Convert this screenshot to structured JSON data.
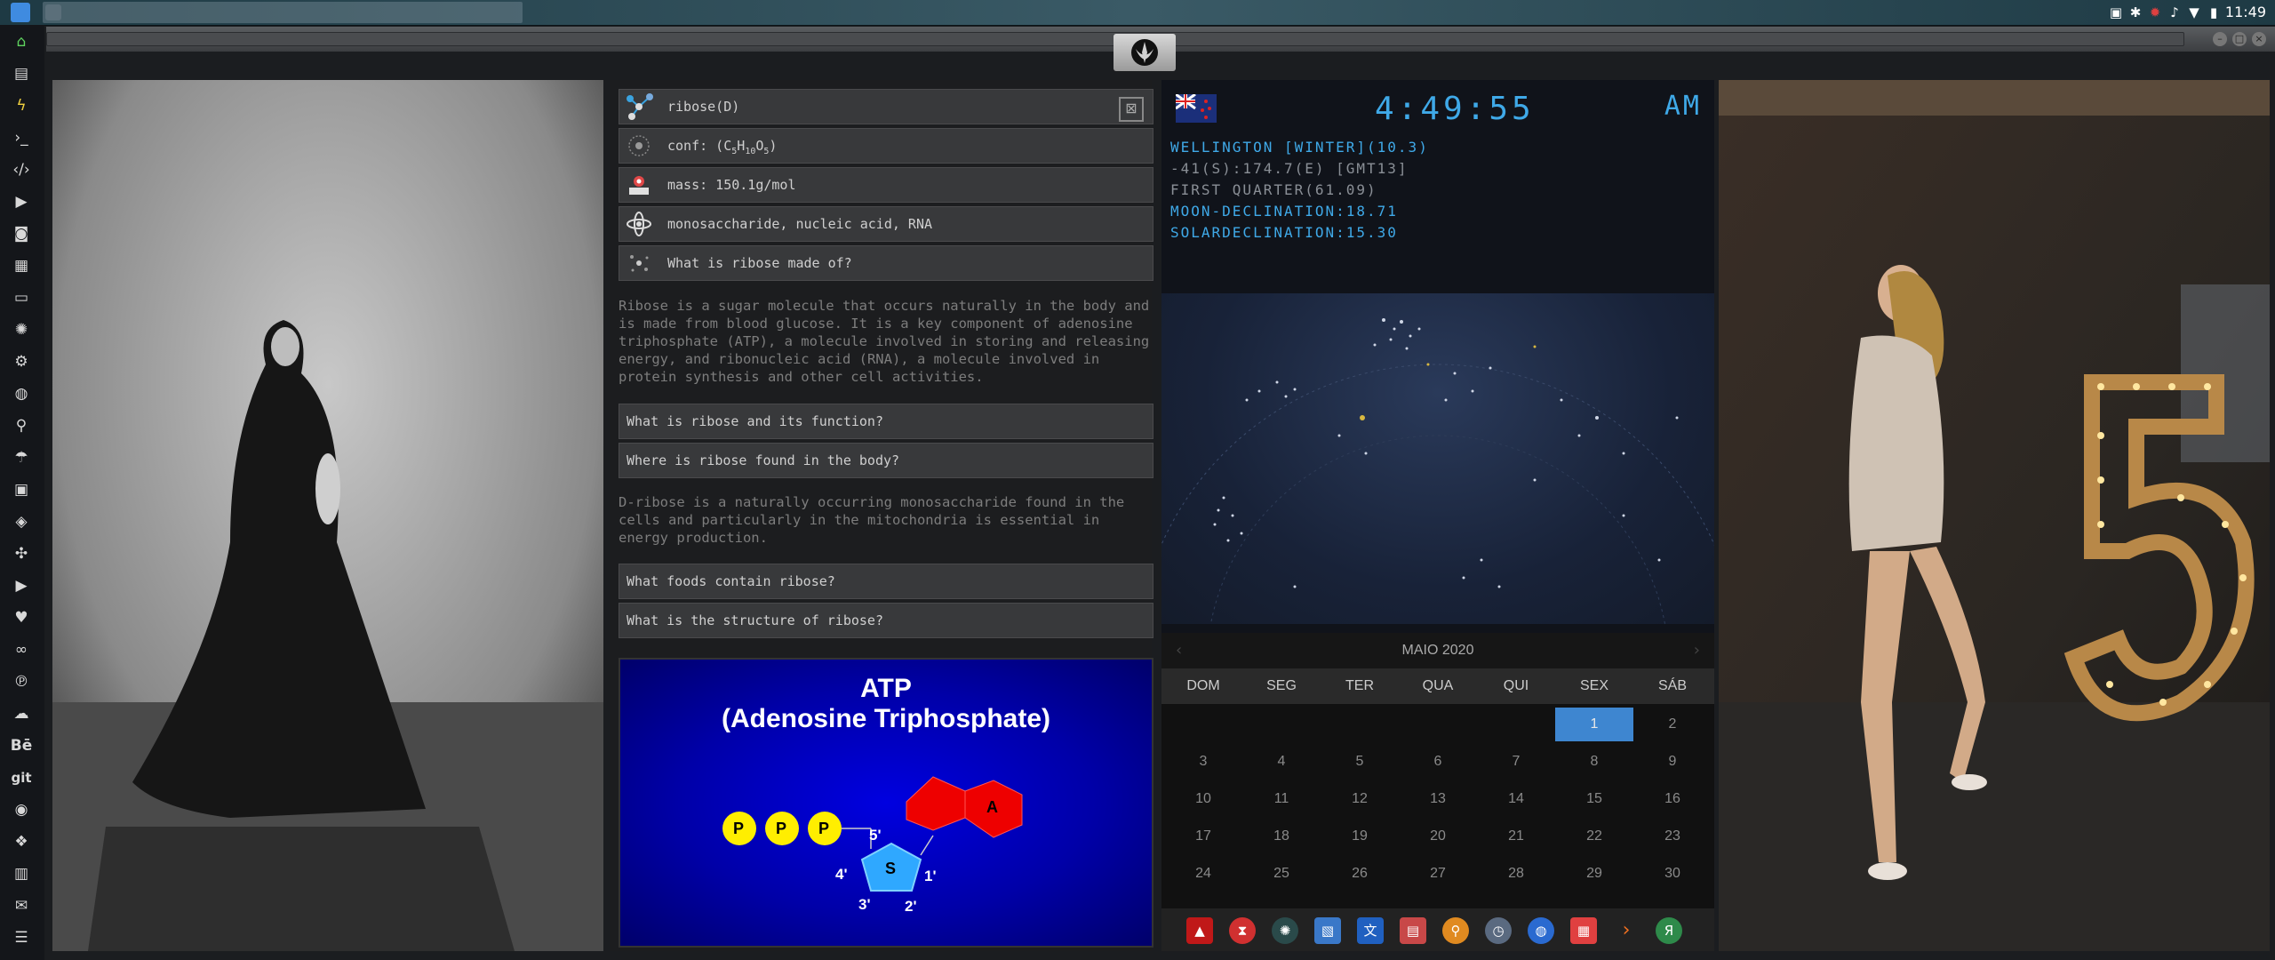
{
  "topbar": {
    "clock": "11:49",
    "tray_icons": [
      "screenshot-icon",
      "bluetooth-icon",
      "bug-icon",
      "volume-icon",
      "wifi-icon",
      "battery-icon"
    ]
  },
  "window": {
    "tab_icon": "rebel-alliance-icon"
  },
  "dock": {
    "items": [
      "home-icon",
      "document-icon",
      "bolt-icon",
      "terminal-icon",
      "code-icon",
      "media-icon",
      "camera-icon",
      "image-icon",
      "id-card-icon",
      "aperture-icon",
      "gear-icon",
      "globe-icon",
      "search-icon",
      "umbrella-icon",
      "contacts-icon",
      "layers-icon",
      "network-icon",
      "youtube-icon",
      "heart-icon",
      "infinity-icon",
      "pinterest-icon",
      "cloud-icon",
      "behance-icon",
      "git-icon",
      "github-icon",
      "cubes-icon",
      "map-icon",
      "mail-icon",
      "server-icon"
    ],
    "behance_label": "Bē",
    "git_label": "git"
  },
  "info": {
    "rows": [
      {
        "icon": "molecule-icon",
        "text": "ribose(D)"
      },
      {
        "icon": "atom-icon",
        "text": "conf: (C5H10O5)"
      },
      {
        "icon": "scale-icon",
        "text": "mass: 150.1g/mol"
      },
      {
        "icon": "orbit-icon",
        "text": "monosaccharide, nucleic acid, RNA"
      },
      {
        "icon": "sparkle-icon",
        "text": "What is ribose made of?"
      }
    ],
    "para1": "Ribose is a sugar molecule that occurs naturally in the body and is made from blood glucose. It is a key component of adenosine triphosphate (ATP), a molecule involved in storing and releasing energy, and ribonucleic acid (RNA), a molecule involved in protein synthesis and other cell activities.",
    "q1": "What is ribose and its function?",
    "q2": "Where is ribose found in the body?",
    "para2": "D-ribose is a naturally occurring monosaccharide found in the cells and particularly in the mitochondria is essential in energy production.",
    "q3": "What foods contain ribose?",
    "q4": "What is the structure of ribose?",
    "close_symbol": "⊠",
    "atp": {
      "title1": "ATP",
      "title2": "(Adenosine Triphosphate)",
      "p": "P",
      "s": "S",
      "a": "A",
      "c5": "5'",
      "c4": "4'",
      "c3": "3'",
      "c2": "2'",
      "c1": "1'"
    }
  },
  "astro": {
    "time": "4:49:55",
    "ampm": "AM",
    "line1": "WELLINGTON [WINTER](10.3)",
    "line2": "-41(S):174.7(E) [GMT13]",
    "line3": "FIRST QUARTER(61.09)",
    "line4": "MOON-DECLINATION:18.71",
    "line5": "SOLARDECLINATION:15.30",
    "colors": {
      "cyan": "#3fa9e8",
      "gray": "#8a8f96"
    }
  },
  "calendar": {
    "title": "MAIO 2020",
    "prev": "‹",
    "next": "›",
    "days": [
      "DOM",
      "SEG",
      "TER",
      "QUA",
      "QUI",
      "SEX",
      "SÁB"
    ],
    "weeks": [
      [
        "",
        "",
        "",
        "",
        "",
        "1",
        "2"
      ],
      [
        "3",
        "4",
        "5",
        "6",
        "7",
        "8",
        "9"
      ],
      [
        "10",
        "11",
        "12",
        "13",
        "14",
        "15",
        "16"
      ],
      [
        "17",
        "18",
        "19",
        "20",
        "21",
        "22",
        "23"
      ],
      [
        "24",
        "25",
        "26",
        "27",
        "28",
        "29",
        "30"
      ]
    ],
    "selected": "1"
  },
  "taskbar": {
    "icons": [
      "arch-icon",
      "hourglass-icon",
      "globe-dark-icon",
      "image-viewer-icon",
      "translate-icon",
      "notes-icon",
      "finder-icon",
      "clock-icon",
      "web-icon",
      "calendar-icon",
      "forward-icon",
      "yandex-icon"
    ],
    "yandex_label": "Я"
  }
}
